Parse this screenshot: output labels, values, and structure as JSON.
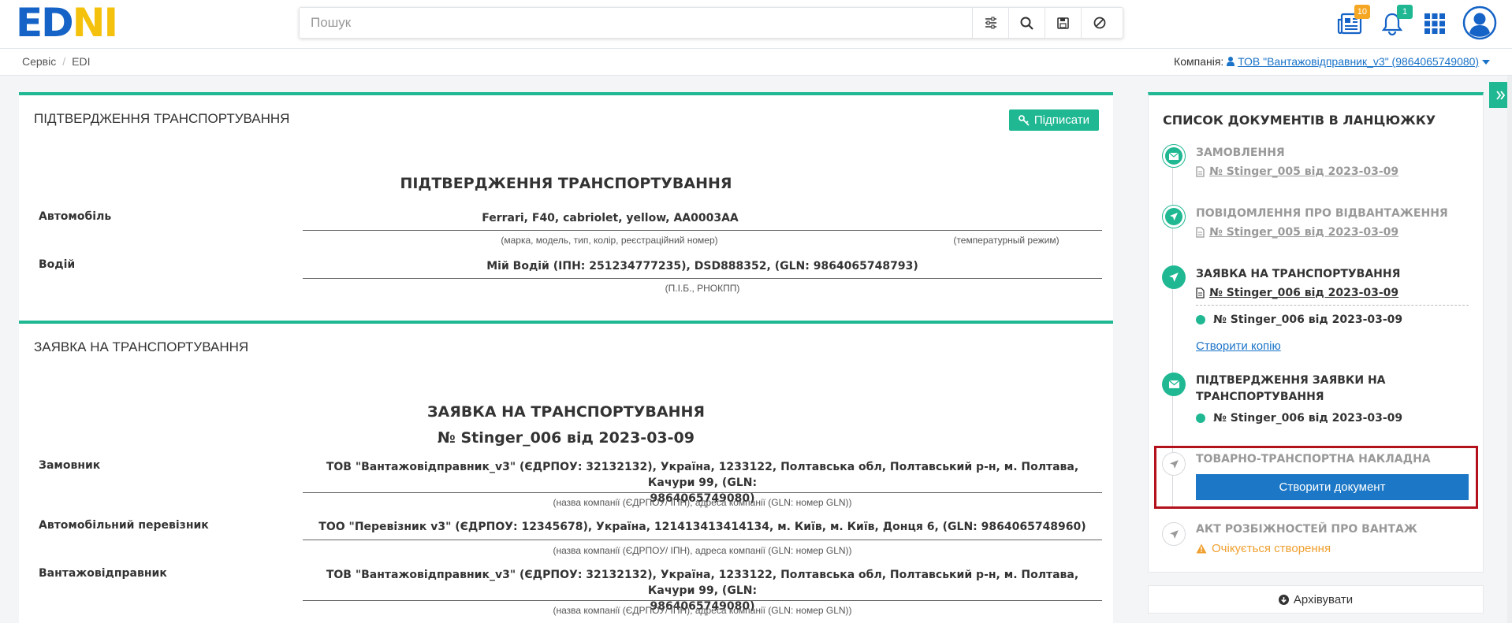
{
  "header": {
    "logo_part1": "ED",
    "logo_part2": "N",
    "logo_part3": "I",
    "search_placeholder": "Пошук",
    "news_count": "10",
    "notifications_count": "1",
    "icons": [
      "filter-icon",
      "search-icon",
      "save-icon",
      "clear-icon",
      "news-icon",
      "bell-icon",
      "apps-grid-icon",
      "user-avatar-icon"
    ],
    "colors": {
      "brand_blue": "#1563c6",
      "brand_yellow": "#f4c20d",
      "accent": "#1fb893",
      "news_badge": "#f5a623"
    }
  },
  "breadcrumb": {
    "items": [
      "Сервіс",
      "EDI"
    ],
    "separator": "/"
  },
  "company": {
    "label": "Компанія:",
    "name": "ТОВ \"Вантажовідправник_v3\" (9864065749080)"
  },
  "confirmation": {
    "title": "ПІДТВЕРДЖЕННЯ ТРАНСПОРТУВАННЯ",
    "sign_button": "Підписати",
    "doc_heading": "ПІДТВЕРДЖЕННЯ ТРАНСПОРТУВАННЯ",
    "rows": [
      {
        "label": "Автомобіль",
        "value": "Ferrari, F40, cabriolet, yellow, AA0003AA",
        "hint": "(марка, модель, тип, колір, реєстраційний номер)",
        "extra_hint": "(температурный режим)"
      },
      {
        "label": "Водій",
        "value": "Мій Водій (ІПН: 251234777235), DSD888352, (GLN: 9864065748793)",
        "hint": "(П.І.Б., РНОКПП)"
      }
    ]
  },
  "request": {
    "title": "ЗАЯВКА НА ТРАНСПОРТУВАННЯ",
    "doc_heading": "ЗАЯВКА НА ТРАНСПОРТУВАННЯ",
    "doc_number": "№ Stinger_006 від 2023-03-09",
    "rows": [
      {
        "label": "Замовник",
        "value_line1": "ТОВ \"Вантажовідправник_v3\" (ЄДРПОУ: 32132132), Україна, 1233122, Полтавська обл, Полтавський р-н, м. Полтава, Качури 99, (GLN:",
        "value_line2": "9864065749080)",
        "hint": "(назва компанії (ЄДРПОУ/ ІПН), адреса компанії (GLN: номер GLN))"
      },
      {
        "label": "Автомобільний перевізник",
        "value_line1": "ТОО \"Перевізник v3\" (ЄДРПОУ: 12345678), Україна, 121413413414134, м. Київ, м. Київ, Донця 6, (GLN: 9864065748960)",
        "value_line2": "",
        "hint": "(назва компанії (ЄДРПОУ/ ІПН), адреса компанії (GLN: номер GLN))"
      },
      {
        "label": "Вантажовідправник",
        "value_line1": "ТОВ \"Вантажовідправник_v3\" (ЄДРПОУ: 32132132), Україна, 1233122, Полтавська обл, Полтавський р-н, м. Полтава, Качури 99, (GLN:",
        "value_line2": "9864065749080)",
        "hint": "(назва компанії (ЄДРПОУ/ ІПН), адреса компанії (GLN: номер GLN))"
      }
    ]
  },
  "chain": {
    "title": "СПИСОК ДОКУМЕНТІВ В ЛАНЦЮЖКУ",
    "steps": [
      {
        "title": "ЗАМОВЛЕННЯ",
        "link": "№ Stinger_005 від 2023-03-09",
        "icon": "envelope-icon"
      },
      {
        "title": "ПОВІДОМЛЕННЯ ПРО ВІДВАНТАЖЕННЯ",
        "link": "№ Stinger_005 від 2023-03-09",
        "icon": "paper-plane-icon"
      },
      {
        "title": "ЗАЯВКА НА ТРАНСПОРТУВАННЯ",
        "link": "№ Stinger_006 від 2023-03-09",
        "sub": "№ Stinger_006 від 2023-03-09",
        "copy": "Створити копію",
        "icon": "paper-plane-icon"
      },
      {
        "title_line1": "ПІДТВЕРДЖЕННЯ ЗАЯВКИ НА",
        "title_line2": "ТРАНСПОРТУВАННЯ",
        "sub": "№ Stinger_006 від 2023-03-09",
        "icon": "envelope-icon"
      },
      {
        "title": "ТОВАРНО-ТРАНСПОРТНА НАКЛАДНА",
        "button": "Створити документ",
        "icon": "paper-plane-icon"
      },
      {
        "title": "АКТ РОЗБІЖНОСТЕЙ ПРО ВАНТАЖ",
        "pending": "Очікується створення",
        "icon": "paper-plane-icon"
      }
    ],
    "archive_button": "Архівувати"
  }
}
